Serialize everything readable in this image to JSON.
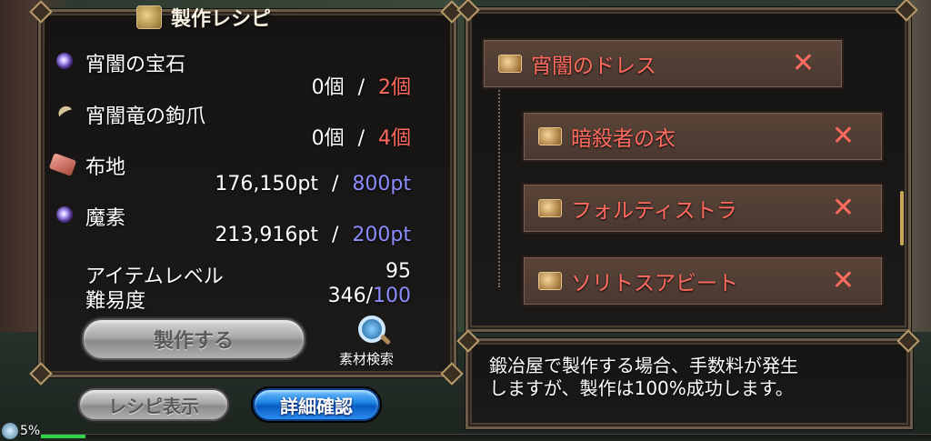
{
  "title": "製作レシピ",
  "materials": [
    {
      "name": "宵闇の宝石",
      "have": "0個",
      "sep": "/",
      "need": "2個",
      "need_color": "red",
      "icon": "gem-orb-icon"
    },
    {
      "name": "宵闇竜の鉤爪",
      "have": "0個",
      "sep": "/",
      "need": "4個",
      "need_color": "red",
      "icon": "claw-icon"
    },
    {
      "name": "布地",
      "have": "176,150pt",
      "sep": "/",
      "need": "800pt",
      "need_color": "blue",
      "icon": "cloth-icon"
    },
    {
      "name": "魔素",
      "have": "213,916pt",
      "sep": "/",
      "need": "200pt",
      "need_color": "blue",
      "icon": "magic-orb-icon"
    }
  ],
  "item_level": {
    "label": "アイテムレベル",
    "value": "95"
  },
  "difficulty": {
    "label": "難易度",
    "value": "346/",
    "limit": "100"
  },
  "buttons": {
    "craft": "製作する",
    "material_search": "素材検索",
    "show_recipe": "レシピ表示",
    "details": "詳細確認"
  },
  "tree": [
    {
      "label": "宵闇のドレス",
      "remove": "✕"
    },
    {
      "label": "暗殺者の衣",
      "remove": "✕"
    },
    {
      "label": "フォルティストラ",
      "remove": "✕"
    },
    {
      "label": "ソリトスアビート",
      "remove": "✕"
    }
  ],
  "message_line1": "鍛冶屋で製作する場合、手数料が発生",
  "message_line2": "しますが、製作は100%成功します。",
  "experience": {
    "text": "5%",
    "fraction": 0.05
  },
  "colors": {
    "red": "#ff6b5e",
    "blue": "#8c8cff",
    "accent_blue": "#1a7fe0"
  }
}
